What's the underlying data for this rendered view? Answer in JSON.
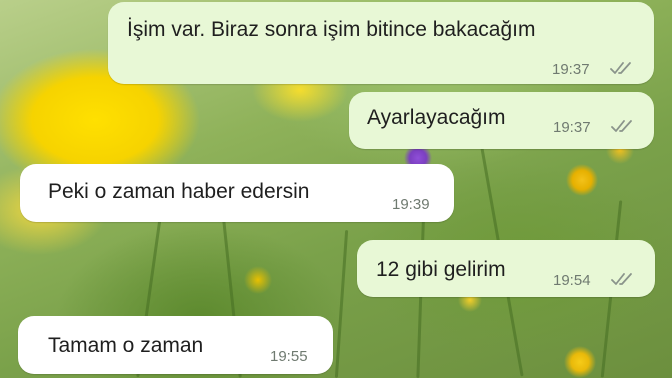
{
  "chat": {
    "messages": [
      {
        "direction": "outgoing",
        "text": "İşim var. Biraz sonra işim bitince bakacağım",
        "time": "19:37",
        "status_icon": "double-check-icon"
      },
      {
        "direction": "outgoing",
        "text": "Ayarlayacağım",
        "time": "19:37",
        "status_icon": "double-check-icon"
      },
      {
        "direction": "incoming",
        "text": "Peki o zaman haber edersin",
        "time": "19:39"
      },
      {
        "direction": "outgoing",
        "text": "12 gibi gelirim",
        "time": "19:54",
        "status_icon": "double-check-icon"
      },
      {
        "direction": "incoming",
        "text": "Tamam o zaman",
        "time": "19:55"
      }
    ]
  },
  "colors": {
    "outgoing_bubble": "#e8f8d6",
    "incoming_bubble": "#ffffff",
    "tick_color": "#8a948b"
  }
}
